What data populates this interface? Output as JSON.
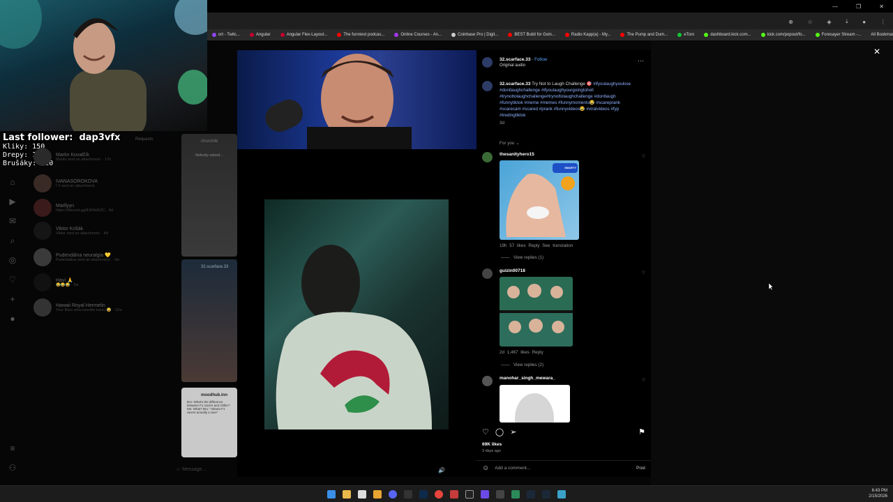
{
  "browser": {
    "tab_hint": "Kovalčík",
    "bookmarks": [
      {
        "label": "ort - Twitc...",
        "color": "#9146ff"
      },
      {
        "label": "Angular",
        "color": "#c3002f"
      },
      {
        "label": "Angular Flex-Layout...",
        "color": "#c3002f"
      },
      {
        "label": "The funniest podcas...",
        "color": "#ff0000"
      },
      {
        "label": "Online Courses - An...",
        "color": "#a435f0"
      },
      {
        "label": "Coinbase Pro | Digit...",
        "color": "#cccccc"
      },
      {
        "label": "BEST Build for Goin...",
        "color": "#ff0000"
      },
      {
        "label": "Radio Kapp(a) - My...",
        "color": "#ff0000"
      },
      {
        "label": "The Pump and Dum...",
        "color": "#ff0000"
      },
      {
        "label": "eToro",
        "color": "#13c636"
      },
      {
        "label": "dashboard.kick.com...",
        "color": "#53fc18"
      },
      {
        "label": "kick.com/popout/fo...",
        "color": "#53fc18"
      },
      {
        "label": "Foresayer Stream -...",
        "color": "#53fc18"
      }
    ],
    "all_bookmarks": "All Bookmarks"
  },
  "overlay": {
    "follower_label": "Last follower:",
    "follower_name": "dap3vfx",
    "rows": [
      {
        "label": "Kliky:",
        "value": "150"
      },
      {
        "label": "Drepy:",
        "value": "120"
      },
      {
        "label": "Brušáky:",
        "value": "120"
      }
    ]
  },
  "dm": {
    "requests": "Requests",
    "items": [
      {
        "name": "Martin Kovalčík",
        "msg": "Martin sent an attachment. · 17h"
      },
      {
        "name": "IVANASOROKOVA",
        "msg": "I V sent an attachment."
      },
      {
        "name": "Marllyyn",
        "msg": "https://discord.gg/8JKNdSZC · 4d"
      },
      {
        "name": "Viktor Krišák",
        "msg": "Viktor sent an attachment. · 4d"
      },
      {
        "name": "Pudendálna neuralgia 💛",
        "msg": "Pudendálna sent an attachment. · 3w"
      },
      {
        "name": "Havi 🙏",
        "msg": "😂😂😂 · 2w"
      },
      {
        "name": "Hawaii Royal Hermelin",
        "msg": "Your Bars veta nevolim karzu 😂 · 12w"
      }
    ]
  },
  "feed": {
    "card1_user": "church4k",
    "card1_caption": "Nobody asked...",
    "card2_user": "32.scarface.33",
    "card3_user": "moodhub.inn",
    "card3_caption": "Bro: What's the difference between F1 racers and chiller? Me: What? Bro: \"Atleast F1 racers actually a race\"",
    "message_placeholder": "Message..."
  },
  "post": {
    "author": "32.scarface.33",
    "follow": "Follow",
    "audio": "Original audio",
    "caption_title": "Try Not to Laugh Challenge 🎯",
    "caption_tags": "#ifyoulaughyoulose #dontlaughchallenge #ifyoulaughyourgoingtohell #trynottolaughchallenge#trynottolaughchallenge #dontlaugh #funnytiktok #meme #memes #funnymoments😂 #scareprank #scarecam #scared #prank #funnyvideos😂 #viralvideos #fyp #tredingtiktok",
    "caption_age": "3d",
    "for_you": "For you ⌄",
    "comments": [
      {
        "user": "thesanityhero15",
        "meta_time": "19h",
        "meta_likes": "57 likes",
        "reply": "Reply",
        "extra": "See translation",
        "view_replies": "View replies (1)"
      },
      {
        "user": "guizin00718",
        "meta_time": "2d",
        "meta_likes": "1,467 likes",
        "reply": "Reply",
        "extra": "",
        "view_replies": "View replies (2)"
      },
      {
        "user": "manohar_singh_mewara_"
      }
    ],
    "thumb1_label": "SMARTY",
    "likes": "69K likes",
    "posted": "3 days ago",
    "add_comment": "Add a comment...",
    "post_btn": "Post"
  },
  "taskbar": {
    "time": "6:43 PM",
    "date": "2/15/2026"
  },
  "colors": {
    "accent": "#0095f6",
    "tag": "#8fb1ff"
  }
}
